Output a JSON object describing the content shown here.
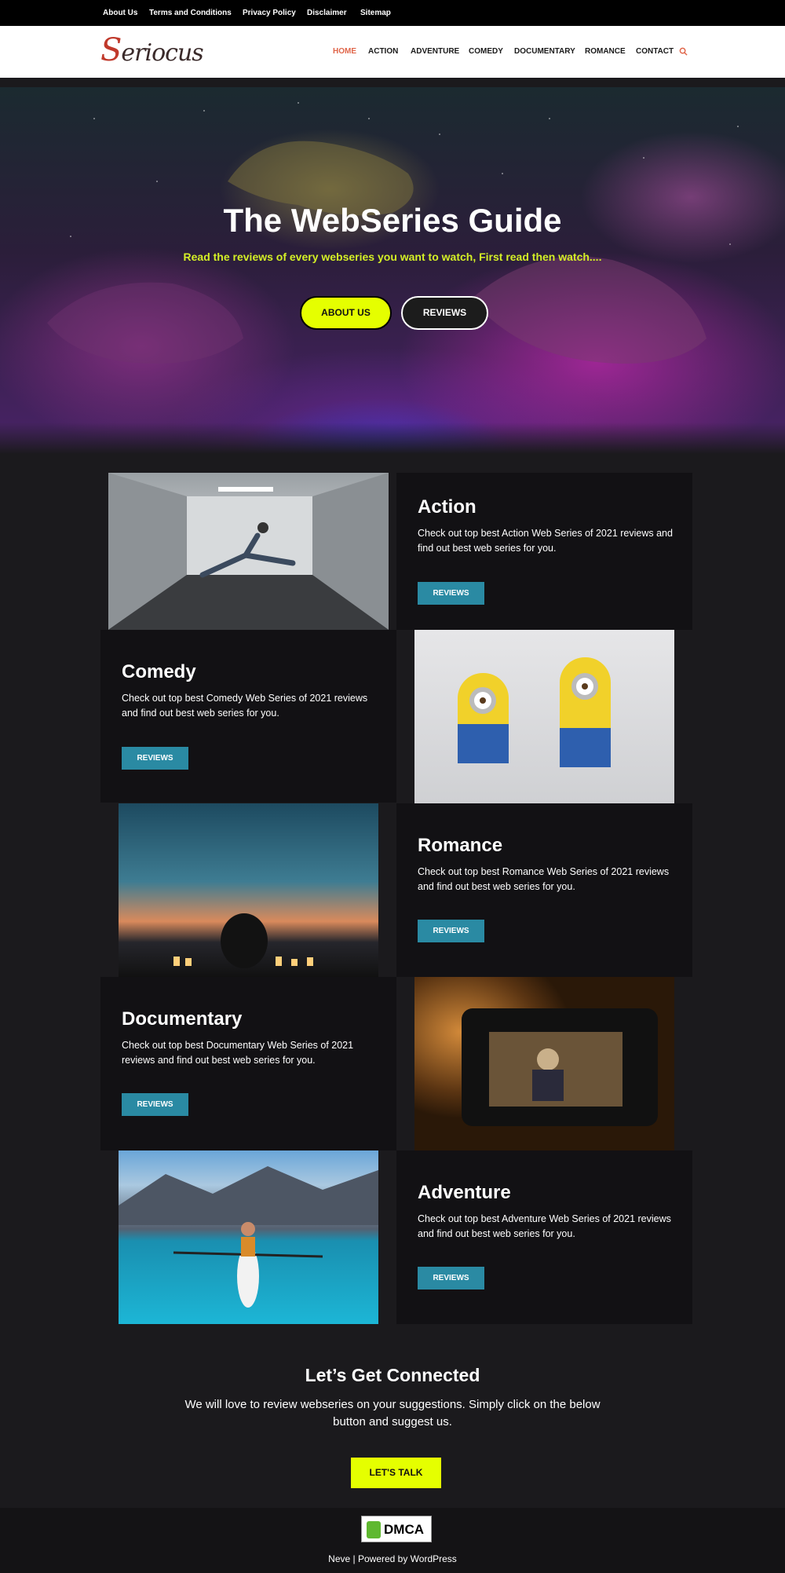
{
  "topbar": {
    "links": [
      "About Us",
      "Terms and Conditions",
      "Privacy Policy",
      "Disclaimer",
      "Sitemap"
    ]
  },
  "header": {
    "logo_cap": "S",
    "logo_rest": "eriocus",
    "nav": [
      "HOME",
      "ACTION",
      "ADVENTURE",
      "COMEDY",
      "DOCUMENTARY",
      "ROMANCE",
      "CONTACT"
    ],
    "active_color": "#e0664a"
  },
  "hero": {
    "title": "The WebSeries Guide",
    "subtitle": "Read the reviews of every webseries you want to watch, First read then watch....",
    "about_label": "ABOUT US",
    "reviews_label": "REVIEWS"
  },
  "sections": [
    {
      "title": "Action",
      "text": "Check out top best Action Web Series of 2021 reviews and find out best web series for you.",
      "button": "REVIEWS"
    },
    {
      "title": "Comedy",
      "text": "Check out top best Comedy Web Series of 2021 reviews and find out best web series for you.",
      "button": "REVIEWS"
    },
    {
      "title": "Romance",
      "text": "Check out top best Romance Web Series of 2021 reviews and find out best web series for you.",
      "button": "REVIEWS"
    },
    {
      "title": "Documentary",
      "text": "Check out top best Documentary Web Series of 2021 reviews and find out best web series for you.",
      "button": "REVIEWS"
    },
    {
      "title": "Adventure",
      "text": "Check out top best Adventure Web Series of 2021 reviews and find out best web series for you.",
      "button": "REVIEWS"
    }
  ],
  "connect": {
    "title": "Let’s Get Connected",
    "text": "We will love to review webseries on your suggestions. Simply click on the below button and suggest us.",
    "button": "LET'S TALK"
  },
  "footer": {
    "badge": "DMCA",
    "credit": "Neve | Powered by WordPress"
  },
  "colors": {
    "accent_yellow": "#e5ff00",
    "button_teal": "#2a8aa3",
    "background": "#1b1a1d"
  }
}
